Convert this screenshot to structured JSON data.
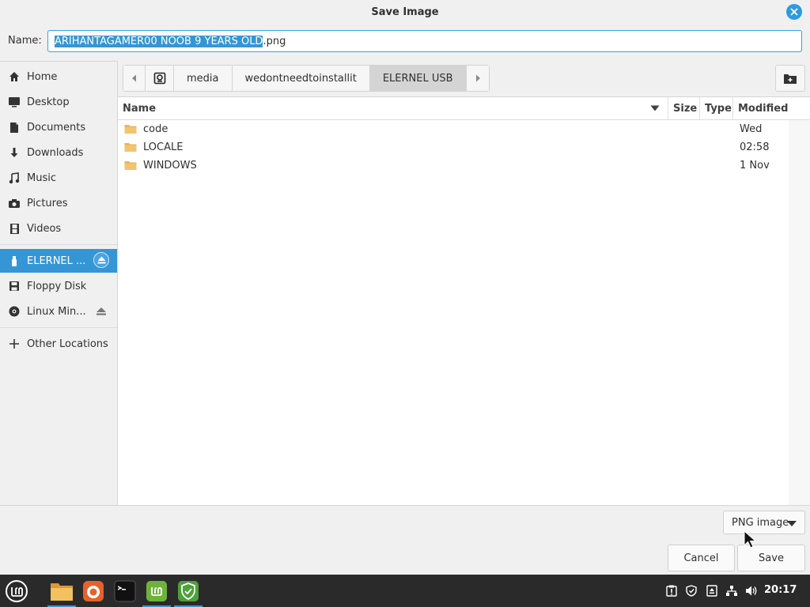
{
  "window": {
    "title": "Save Image"
  },
  "name_field": {
    "label": "Name:",
    "selected_part": "ARIHANTAGAMER00 NOOB 9 YEARS OLD",
    "extension_part": ".png"
  },
  "sidebar": {
    "items": [
      {
        "label": "Home",
        "icon": "home-icon"
      },
      {
        "label": "Desktop",
        "icon": "desktop-icon"
      },
      {
        "label": "Documents",
        "icon": "documents-icon"
      },
      {
        "label": "Downloads",
        "icon": "downloads-icon"
      },
      {
        "label": "Music",
        "icon": "music-icon"
      },
      {
        "label": "Pictures",
        "icon": "pictures-icon"
      },
      {
        "label": "Videos",
        "icon": "videos-icon"
      },
      {
        "label": "ELERNEL ...",
        "icon": "usb-icon",
        "active": true
      },
      {
        "label": "Floppy Disk",
        "icon": "floppy-icon"
      },
      {
        "label": "Linux Min...",
        "icon": "disc-icon"
      },
      {
        "label": "Other Locations",
        "icon": "plus-icon"
      }
    ]
  },
  "pathbar": {
    "segments": [
      "media",
      "wedontneedtoinstallit",
      "ELERNEL USB"
    ]
  },
  "columns": {
    "name": "Name",
    "size": "Size",
    "type": "Type",
    "modified": "Modified"
  },
  "files": [
    {
      "name": "code",
      "modified": "Wed"
    },
    {
      "name": "LOCALE",
      "modified": "02:58"
    },
    {
      "name": "WINDOWS",
      "modified": "1 Nov"
    }
  ],
  "filter": {
    "value": "PNG image"
  },
  "buttons": {
    "cancel": "Cancel",
    "save": "Save"
  },
  "taskbar": {
    "clock": "20:17"
  },
  "colors": {
    "accent": "#3596d5",
    "folder": "#e8b75a",
    "taskbar": "#2a2a2a"
  }
}
